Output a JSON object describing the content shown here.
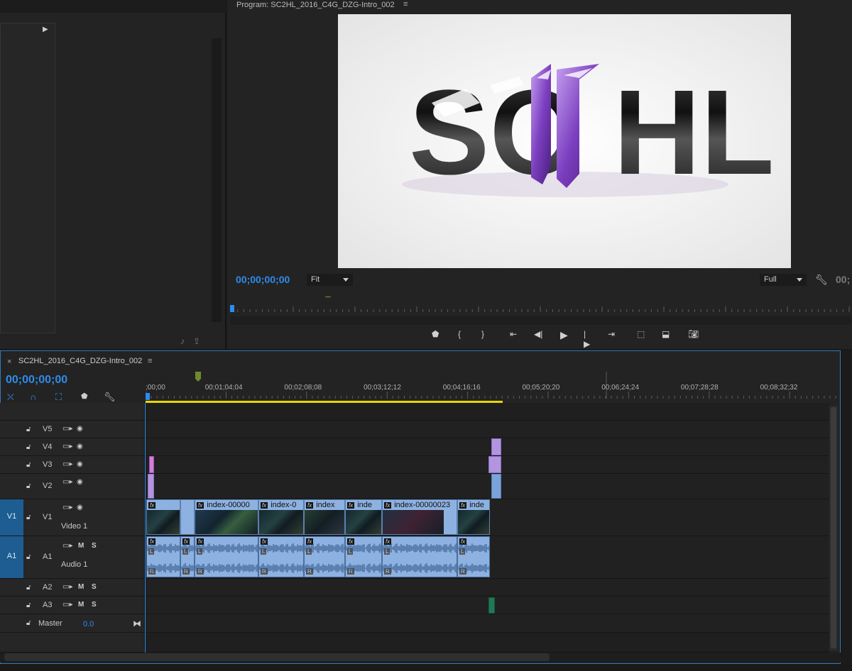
{
  "program_monitor": {
    "title": "Program: SC2HL_2016_C4G_DZG-Intro_002",
    "menu_icon": "hamburger-icon",
    "logo_text": "SC2HL",
    "timecode": "00;00;00;00",
    "zoom": "Fit",
    "resolution": "Full",
    "timecode_cut": "00;",
    "transport": [
      "add-marker-icon",
      "mark-in-icon",
      "mark-out-icon",
      "go-to-in-icon",
      "step-back-icon",
      "play-icon",
      "step-forward-icon",
      "go-to-out-icon",
      "lift-icon",
      "extract-icon",
      "export-frame-icon"
    ]
  },
  "sequence": {
    "tab_name": "SC2HL_2016_C4G_DZG-Intro_002",
    "timecode": "00;00;00;00",
    "ruler_labels": [
      ";00;00",
      "00;01;04;04",
      "00;02;08;08",
      "00;03;12;12",
      "00;04;16;16",
      "00;05;20;20",
      "00;06;24;24",
      "00;07;28;28",
      "00;08;32;32"
    ],
    "tracks": {
      "v5": "V5",
      "v4": "V4",
      "v3": "V3",
      "v2": "V2",
      "v1": "V1",
      "v1_target": "V1",
      "v1_label": "Video 1",
      "a1": "A1",
      "a1_target": "A1",
      "a1_label": "Audio 1",
      "a2": "A2",
      "a3": "A3",
      "master": "Master",
      "master_value": "0.0"
    },
    "mute": "M",
    "solo": "S",
    "clips": [
      "index-00000",
      "index-0",
      "index",
      "inde",
      "index-00000023",
      "inde"
    ],
    "audio_left": "L",
    "audio_right": "R"
  },
  "colors": {
    "accent": "#2d8ceb",
    "video_clip": "#8db1e0",
    "purple_clip": "#b394e0",
    "work_area": "#e8d800"
  }
}
